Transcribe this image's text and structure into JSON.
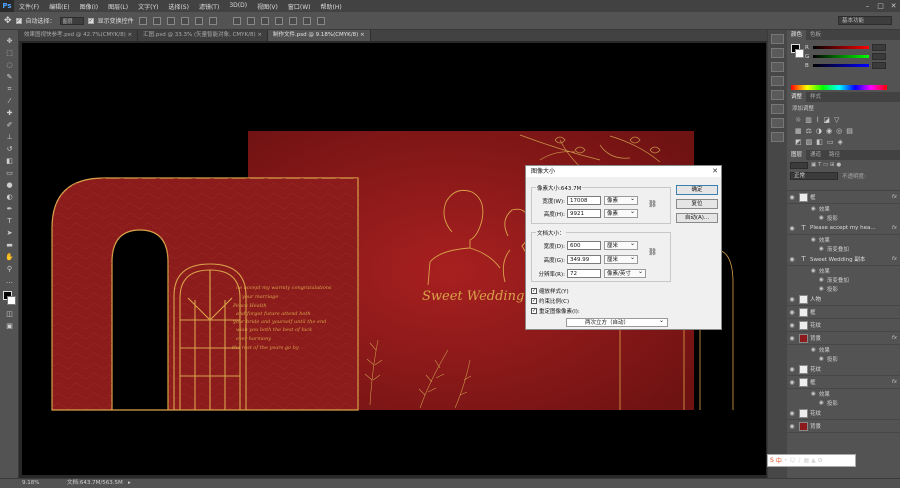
{
  "app": {
    "logo": "Ps"
  },
  "menu": [
    "文件(F)",
    "编辑(E)",
    "图像(I)",
    "图层(L)",
    "文字(Y)",
    "选择(S)",
    "滤镜(T)",
    "3D(D)",
    "视图(V)",
    "窗口(W)",
    "帮助(H)"
  ],
  "options": {
    "auto_select": "自动选择：",
    "auto_select_target": "图层",
    "show_transform": "显示变换控件",
    "workspace": "基本功能"
  },
  "tabs": [
    {
      "label": "效果图视快参考.psd @ 42.7%(CMYK/8) ×"
    },
    {
      "label": "汇图.psd @ 33.3% (矢量智能对象, CMYK/8) ×"
    },
    {
      "label": "制作文件.psd @ 9.18%(CMYK/8) ×"
    }
  ],
  "design": {
    "left_text": [
      "ne accept my warmly congratulations",
      "your marriage",
      "Peace Health",
      "and forget future attend both",
      "your bride and yourself until the end",
      "wish you both the best of luck",
      "ever harmony",
      "the rest of the years go by"
    ],
    "sweet_wedding": "Sweet Wedding"
  },
  "dialog": {
    "title": "图像大小",
    "pixel_dim_label": "像素大小:643.7M",
    "width_label": "宽度(W):",
    "width_value": "17008",
    "width_unit": "像素",
    "height_label": "高度(H):",
    "height_value": "9921",
    "height_unit": "像素",
    "doc_size_label": "文档大小：",
    "doc_width_label": "宽度(D):",
    "doc_width_value": "600",
    "doc_width_unit": "厘米",
    "doc_height_label": "高度(G):",
    "doc_height_value": "349.99",
    "doc_height_unit": "厘米",
    "resolution_label": "分辨率(R):",
    "resolution_value": "72",
    "resolution_unit": "像素/英寸",
    "ok": "确定",
    "reset": "复位",
    "auto": "自动(A)...",
    "scale_styles": "缩放样式(Y)",
    "constrain": "约束比例(C)",
    "resample": "重定图像像素(I):",
    "resample_method": "两次立方（自动）"
  },
  "panels": {
    "color_tabs": [
      "颜色",
      "色板"
    ],
    "color_channels": [
      "R",
      "G",
      "B"
    ],
    "adjust_tabs": [
      "调整",
      "样式"
    ],
    "adjust_title": "添加调整",
    "layer_tabs": [
      "图层",
      "通道",
      "路径"
    ],
    "blend_mode": "正常",
    "opacity_label": "不透明度:",
    "layers": [
      {
        "kind": "layer",
        "thumb": "w",
        "name": "框",
        "fx": "fx"
      },
      {
        "kind": "sub",
        "name": "效果"
      },
      {
        "kind": "sub2",
        "name": "投影"
      },
      {
        "kind": "layer",
        "thumb": "t",
        "name": "Please accept my hea...",
        "fx": "fx"
      },
      {
        "kind": "sub",
        "name": "效果"
      },
      {
        "kind": "sub2",
        "name": "渐变叠加"
      },
      {
        "kind": "layer",
        "thumb": "t",
        "name": "Sweet  Wedding 副本",
        "fx": "fx"
      },
      {
        "kind": "sub",
        "name": "效果"
      },
      {
        "kind": "sub2",
        "name": "渐变叠加"
      },
      {
        "kind": "sub2",
        "name": "投影"
      },
      {
        "kind": "layer",
        "thumb": "w",
        "name": "人物",
        "fx": ""
      },
      {
        "kind": "layer",
        "thumb": "w",
        "name": "框",
        "fx": ""
      },
      {
        "kind": "layer",
        "thumb": "w",
        "name": "花纹",
        "fx": ""
      },
      {
        "kind": "layer",
        "thumb": "r",
        "name": "背景",
        "fx": "fx"
      },
      {
        "kind": "sub",
        "name": "效果"
      },
      {
        "kind": "sub2",
        "name": "投影"
      },
      {
        "kind": "layer",
        "thumb": "w",
        "name": "花纹",
        "fx": ""
      },
      {
        "kind": "layer",
        "thumb": "w",
        "name": "框",
        "fx": "fx"
      },
      {
        "kind": "sub",
        "name": "效果"
      },
      {
        "kind": "sub2",
        "name": "投影"
      },
      {
        "kind": "layer",
        "thumb": "w",
        "name": "花纹",
        "fx": ""
      },
      {
        "kind": "layer",
        "thumb": "r",
        "name": "背景",
        "fx": ""
      }
    ]
  },
  "status": {
    "zoom": "9.18%",
    "doc": "文档:643.7M/563.5M"
  },
  "ime": {
    "label": "中"
  },
  "colors": {
    "accent_gold": "#d9a24a",
    "wall_red": "#8c1c1c"
  }
}
